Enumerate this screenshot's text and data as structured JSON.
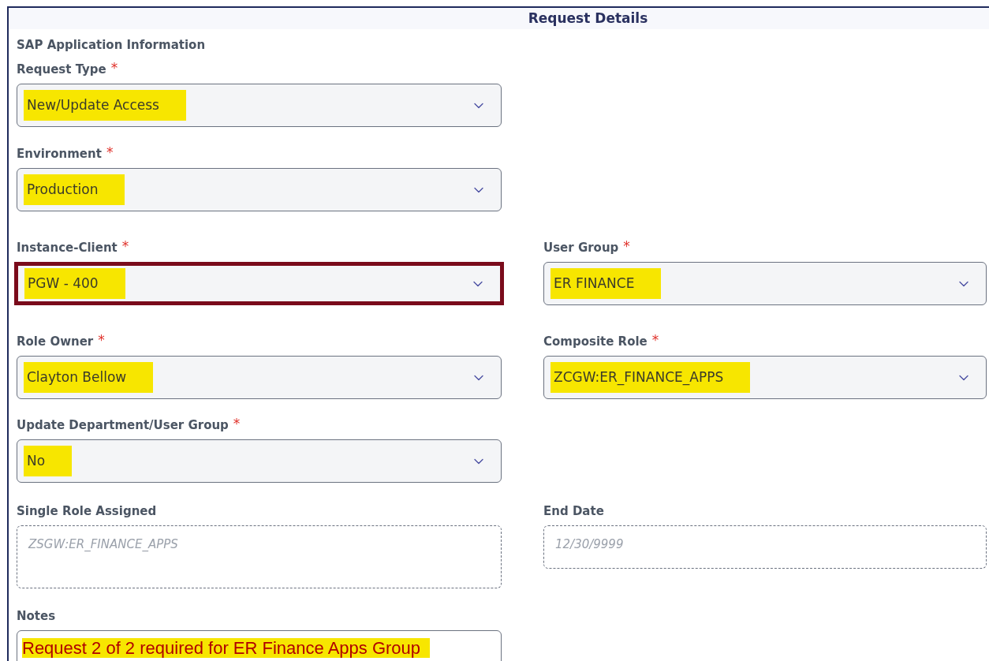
{
  "header": {
    "title": "Request Details"
  },
  "section": {
    "title": "SAP Application Information"
  },
  "rows": [
    {
      "left": {
        "kind": "select",
        "label": "Request Type",
        "required_mark": "*",
        "value": "New/Update Access",
        "highlighted": true,
        "outlined": false
      }
    },
    {
      "left": {
        "kind": "select",
        "label": "Environment",
        "required_mark": "*",
        "value": "Production",
        "highlighted": true,
        "outlined": false
      }
    },
    {
      "left": {
        "kind": "select",
        "label": "Instance-Client",
        "required_mark": "*",
        "value": "PGW - 400",
        "highlighted": true,
        "outlined": true
      },
      "right": {
        "kind": "select",
        "label": "User Group",
        "required_mark": "*",
        "value": "ER FINANCE",
        "highlighted": true,
        "outlined": false
      }
    },
    {
      "left": {
        "kind": "select",
        "label": "Role Owner",
        "required_mark": "*",
        "value": "Clayton Bellow",
        "highlighted": true,
        "outlined": false
      },
      "right": {
        "kind": "select",
        "label": "Composite Role",
        "required_mark": "*",
        "value": "ZCGW:ER_FINANCE_APPS",
        "highlighted": true,
        "outlined": false
      }
    },
    {
      "left": {
        "kind": "select",
        "label": "Update Department/User Group",
        "required_mark": "*",
        "value": "No",
        "highlighted": true,
        "outlined": false
      }
    },
    {
      "left": {
        "kind": "readonly",
        "label": "Single Role Assigned",
        "placeholder": "ZSGW:ER_FINANCE_APPS",
        "tall": true
      },
      "right": {
        "kind": "readonly",
        "label": "End Date",
        "placeholder": "12/30/9999",
        "tall": false
      }
    },
    {
      "left": {
        "kind": "notes",
        "label": "Notes",
        "value": "Request 2 of 2 required for ER Finance Apps Group",
        "highlighted": true
      }
    }
  ]
}
